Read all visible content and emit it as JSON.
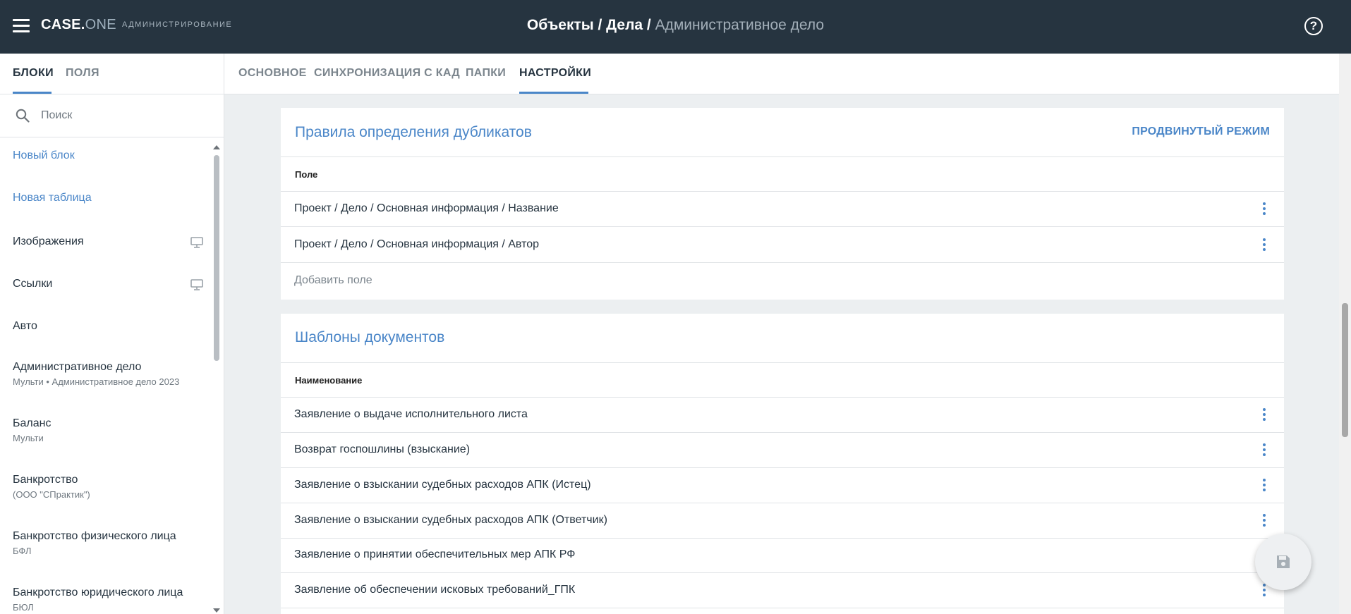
{
  "header": {
    "logo_main": "CASE.",
    "logo_suffix": "ONE",
    "section": "АДМИНИСТРИРОВАНИЕ",
    "breadcrumb_path": "Объекты / Дела / ",
    "breadcrumb_current": "Административное дело",
    "help_glyph": "?"
  },
  "sidebar": {
    "tabs": [
      {
        "label": "БЛОКИ",
        "active": true
      },
      {
        "label": "ПОЛЯ",
        "active": false
      }
    ],
    "search_placeholder": "Поиск",
    "items": [
      {
        "name": "Новый блок",
        "sub": "",
        "link": true,
        "icon": ""
      },
      {
        "name": "Новая таблица",
        "sub": "",
        "link": true,
        "icon": ""
      },
      {
        "name": "Изображения",
        "sub": "",
        "link": false,
        "icon": "monitor-icon"
      },
      {
        "name": "Ссылки",
        "sub": "",
        "link": false,
        "icon": "monitor-icon"
      },
      {
        "name": "Авто",
        "sub": "",
        "link": false,
        "icon": ""
      },
      {
        "name": "Административное дело",
        "sub": "Мульти • Административное дело 2023",
        "link": false,
        "icon": ""
      },
      {
        "name": "Баланс",
        "sub": "Мульти",
        "link": false,
        "icon": ""
      },
      {
        "name": "Банкротство",
        "sub": "(ООО \"СПрактик\")",
        "link": false,
        "icon": ""
      },
      {
        "name": "Банкротство физического лица",
        "sub": "БФЛ",
        "link": false,
        "icon": ""
      },
      {
        "name": "Банкротство юридического лица",
        "sub": "БЮЛ",
        "link": false,
        "icon": ""
      }
    ]
  },
  "main_tabs": [
    {
      "label": "ОСНОВНОЕ",
      "active": false
    },
    {
      "label": "СИНХРОНИЗАЦИЯ С КАД",
      "active": false
    },
    {
      "label": "ПАПКИ",
      "active": false
    },
    {
      "label": "НАСТРОЙКИ",
      "active": true
    }
  ],
  "duplicates": {
    "title": "Правила определения дубликатов",
    "action": "ПРОДВИНУТЫЙ РЕЖИМ",
    "column": "Поле",
    "rows": [
      "Проект / Дело / Основная информация / Название",
      "Проект / Дело / Основная информация / Автор"
    ],
    "add_label": "Добавить поле"
  },
  "templates": {
    "title": "Шаблоны документов",
    "column": "Наименование",
    "rows": [
      "Заявление о выдаче исполнительного листа",
      "Возврат госпошлины (взыскание)",
      "Заявление о взыскании судебных расходов АПК (Истец)",
      "Заявление о взыскании судебных расходов АПК (Ответчик)",
      "Заявление о принятии обеспечительных мер АПК РФ",
      "Заявление об обеспечении исковых требований_ГПК"
    ]
  },
  "colors": {
    "header_bg": "#263440",
    "accent": "#4a86c8",
    "page_bg": "#eceff1"
  }
}
